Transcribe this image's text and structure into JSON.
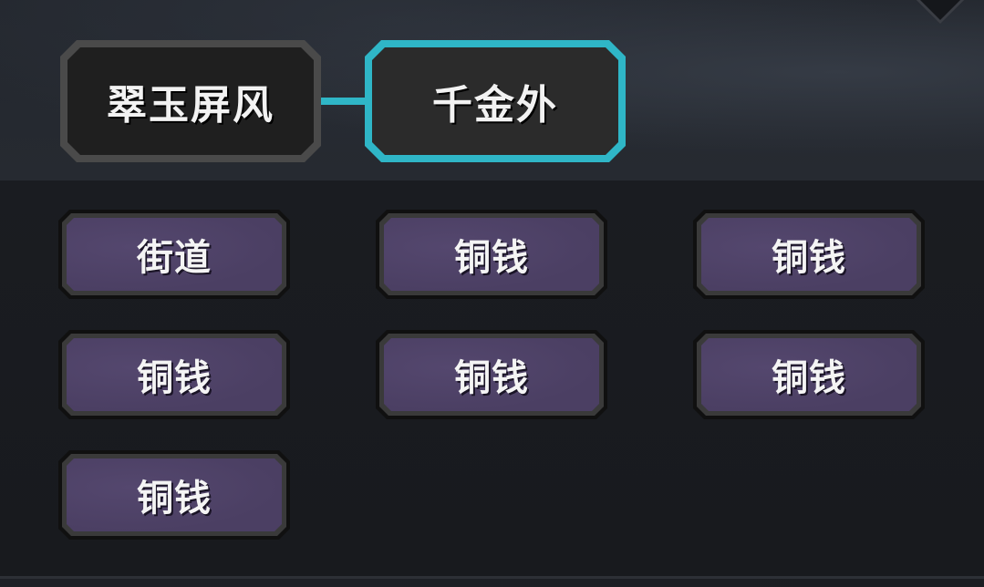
{
  "tiers": [
    {
      "label": "翠玉屏风",
      "state": "inactive"
    },
    {
      "label": "千金外",
      "state": "active"
    }
  ],
  "colors": {
    "accent": "#2fb6c7",
    "slot_fill": "#4b3f63",
    "background": "#1b1d22"
  },
  "icons": {
    "corner": "diamond-corner-icon"
  },
  "items": [
    {
      "label": "街道"
    },
    {
      "label": "铜钱"
    },
    {
      "label": "铜钱"
    },
    {
      "label": "铜钱"
    },
    {
      "label": "铜钱"
    },
    {
      "label": "铜钱"
    },
    {
      "label": "铜钱"
    }
  ]
}
